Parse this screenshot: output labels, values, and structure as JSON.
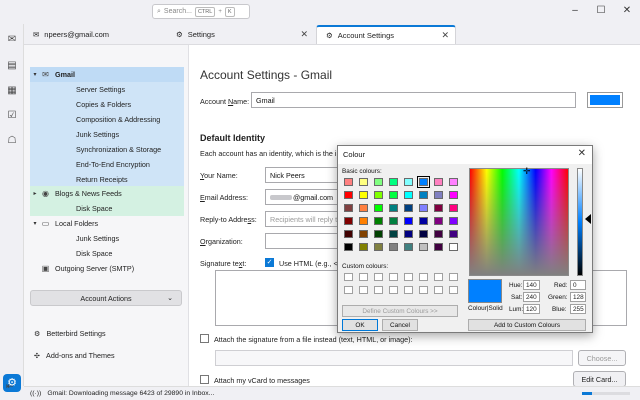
{
  "titlebar": {
    "search_placeholder": "Search...",
    "shortcut_key1": "CTRL",
    "shortcut_key2": "K"
  },
  "tabs": [
    {
      "label": "npeers@gmail.com",
      "icon": "mail-icon",
      "active": false
    },
    {
      "label": "Settings",
      "icon": "gear-icon",
      "active": false
    },
    {
      "label": "Account Settings",
      "icon": "gear-icon",
      "active": true
    }
  ],
  "tree": {
    "items": [
      {
        "label": "Gmail",
        "level": 0,
        "icon": "mail-icon",
        "twisty": "▾",
        "style": "sel",
        "bold": true
      },
      {
        "label": "Server Settings",
        "level": 1,
        "style": "selc"
      },
      {
        "label": "Copies & Folders",
        "level": 1,
        "style": "selc"
      },
      {
        "label": "Composition & Addressing",
        "level": 1,
        "style": "selc"
      },
      {
        "label": "Junk Settings",
        "level": 1,
        "style": "selc"
      },
      {
        "label": "Synchronization & Storage",
        "level": 1,
        "style": "selc"
      },
      {
        "label": "End-To-End Encryption",
        "level": 1,
        "style": "selc"
      },
      {
        "label": "Return Receipts",
        "level": 1,
        "style": "selc"
      },
      {
        "label": "Blogs & News Feeds",
        "level": 0,
        "icon": "rss-icon",
        "twisty": "▸",
        "style": "green"
      },
      {
        "label": "Disk Space",
        "level": 1,
        "style": "green"
      },
      {
        "label": "Local Folders",
        "level": 0,
        "icon": "folder-icon",
        "twisty": "▾",
        "style": ""
      },
      {
        "label": "Junk Settings",
        "level": 1,
        "style": ""
      },
      {
        "label": "Disk Space",
        "level": 1,
        "style": ""
      },
      {
        "label": "Outgoing Server (SMTP)",
        "level": 0,
        "icon": "server-icon",
        "twisty": "",
        "style": ""
      }
    ],
    "account_actions": "Account Actions",
    "footer": [
      {
        "label": "Betterbird Settings",
        "icon": "gear-icon"
      },
      {
        "label": "Add-ons and Themes",
        "icon": "puzzle-icon"
      }
    ]
  },
  "panel": {
    "title": "Account Settings - Gmail",
    "account_name_label": "Account Name:",
    "account_name_value": "Gmail",
    "account_color": "#0080ff",
    "default_identity": "Default Identity",
    "identity_desc": "Each account has an identity, which is the informa",
    "your_name_label": "Your Name:",
    "your_name_value": "Nick Peers",
    "email_label": "Email Address:",
    "email_value": "@gmail.com",
    "reply_to_label": "Reply-to Address:",
    "reply_to_placeholder": "Recipients will reply to this",
    "organization_label": "Organization:",
    "signature_label": "Signature text:",
    "use_html_label": "Use HTML (e.g., <b>bold",
    "attach_sig_label": "Attach the signature from a file instead (text, HTML, or image):",
    "choose_label": "Choose...",
    "attach_vcard_label": "Attach my vCard to messages",
    "edit_card_label": "Edit Card..."
  },
  "status": {
    "text": "Gmail: Downloading message 6423 of 29890 in Inbox...",
    "progress": 0.21
  },
  "colour_dialog": {
    "title": "Colour",
    "basic_colours_label": "Basic colours:",
    "custom_colours_label": "Custom colours:",
    "define_custom_label": "Define Custom Colours >>",
    "ok_label": "OK",
    "cancel_label": "Cancel",
    "colour_solid_label": "Colour|Solid",
    "add_custom_label": "Add to Custom Colours",
    "hue_label": "Hue:",
    "hue": "140",
    "sat_label": "Sat:",
    "sat": "240",
    "lum_label": "Lum:",
    "lum": "120",
    "red_label": "Red:",
    "red": "0",
    "green_label": "Green:",
    "green": "128",
    "blue_label": "Blue:",
    "blue": "255",
    "selected_colour": "#0080ff",
    "basic_colours": [
      "#ff8080",
      "#ffff80",
      "#80ff80",
      "#00ff80",
      "#80ffff",
      "#0080ff",
      "#ff80c0",
      "#ff80ff",
      "#ff0000",
      "#ffff00",
      "#80ff00",
      "#00ff40",
      "#00ffff",
      "#0080c0",
      "#8080c0",
      "#ff00ff",
      "#804040",
      "#ff8040",
      "#00ff00",
      "#008080",
      "#004080",
      "#8080ff",
      "#800040",
      "#ff0080",
      "#800000",
      "#ff8000",
      "#008000",
      "#008040",
      "#0000ff",
      "#0000a0",
      "#800080",
      "#8000ff",
      "#400000",
      "#804000",
      "#004000",
      "#004040",
      "#000080",
      "#000040",
      "#400040",
      "#400080",
      "#000000",
      "#808000",
      "#808040",
      "#808080",
      "#408080",
      "#c0c0c0",
      "#400040",
      "#ffffff"
    ],
    "selected_index": 5
  }
}
